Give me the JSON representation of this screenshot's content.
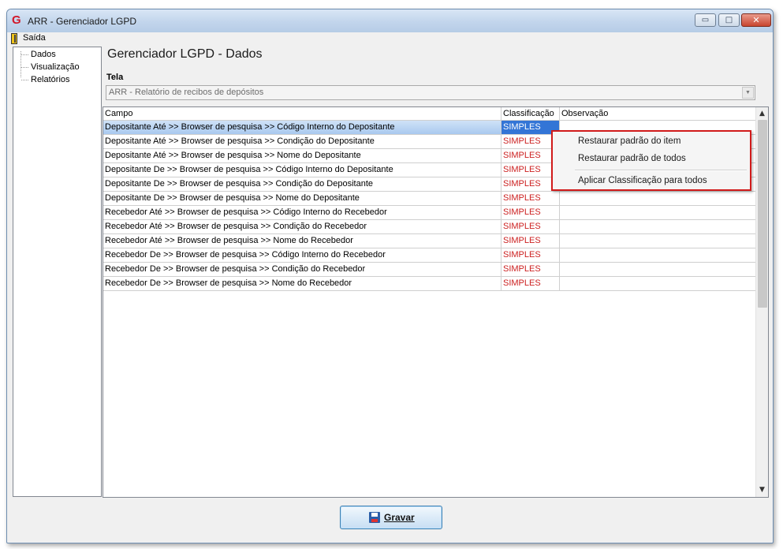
{
  "window": {
    "title": "ARR - Gerenciador LGPD",
    "minimize_glyph": "▭",
    "maximize_glyph": "□",
    "close_glyph": "✕"
  },
  "menu": {
    "exit_label": "Saída"
  },
  "nav": {
    "items": [
      {
        "label": "Dados"
      },
      {
        "label": "Visualização"
      },
      {
        "label": "Relatórios"
      }
    ]
  },
  "main": {
    "title": "Gerenciador LGPD - Dados",
    "screen_label": "Tela",
    "screen_value": "ARR - Relatório de recibos de depósitos",
    "dropdown_glyph": "▼"
  },
  "grid": {
    "headers": {
      "campo": "Campo",
      "classificacao": "Classificação",
      "observacao": "Observação"
    },
    "rows": [
      {
        "campo": "Depositante Até >> Browser de pesquisa >> Código Interno do Depositante",
        "classificacao": "SIMPLES",
        "observacao": ""
      },
      {
        "campo": "Depositante Até >> Browser de pesquisa >> Condição do Depositante",
        "classificacao": "SIMPLES",
        "observacao": ""
      },
      {
        "campo": "Depositante Até >> Browser de pesquisa >> Nome do Depositante",
        "classificacao": "SIMPLES",
        "observacao": ""
      },
      {
        "campo": "Depositante De >> Browser de pesquisa >> Código Interno do Depositante",
        "classificacao": "SIMPLES",
        "observacao": ""
      },
      {
        "campo": "Depositante De >> Browser de pesquisa >> Condição do Depositante",
        "classificacao": "SIMPLES",
        "observacao": ""
      },
      {
        "campo": "Depositante De >> Browser de pesquisa >> Nome do Depositante",
        "classificacao": "SIMPLES",
        "observacao": ""
      },
      {
        "campo": "Recebedor Até >> Browser de pesquisa >> Código Interno do Recebedor",
        "classificacao": "SIMPLES",
        "observacao": ""
      },
      {
        "campo": "Recebedor Até >> Browser de pesquisa >> Condição do Recebedor",
        "classificacao": "SIMPLES",
        "observacao": ""
      },
      {
        "campo": "Recebedor Até >> Browser de pesquisa >> Nome do Recebedor",
        "classificacao": "SIMPLES",
        "observacao": ""
      },
      {
        "campo": "Recebedor De >> Browser de pesquisa >> Código Interno do Recebedor",
        "classificacao": "SIMPLES",
        "observacao": ""
      },
      {
        "campo": "Recebedor De >> Browser de pesquisa >> Condição do Recebedor",
        "classificacao": "SIMPLES",
        "observacao": ""
      },
      {
        "campo": "Recebedor De >> Browser de pesquisa >> Nome do Recebedor",
        "classificacao": "SIMPLES",
        "observacao": ""
      }
    ],
    "scroll_up_glyph": "▲",
    "scroll_down_glyph": "▼"
  },
  "context_menu": {
    "items": [
      {
        "label": "Restaurar padrão do item"
      },
      {
        "label": "Restaurar padrão de todos"
      },
      {
        "label": "Aplicar Classificação para todos"
      }
    ]
  },
  "footer": {
    "save_label": "Gravar"
  },
  "colors": {
    "classification_text": "#cc1f1f",
    "selection_blue": "#3375d6",
    "context_menu_highlight_border": "#d11b1b"
  }
}
